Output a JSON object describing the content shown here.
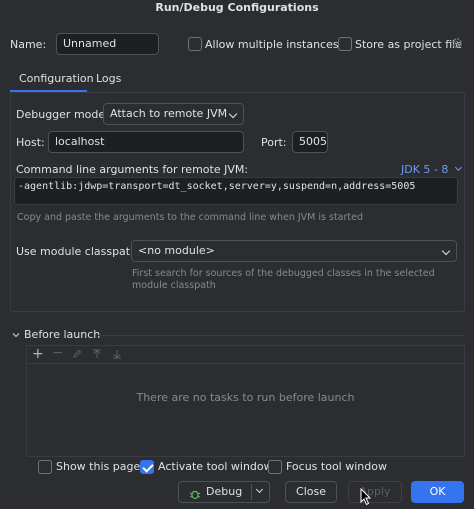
{
  "dialog": {
    "title": "Run/Debug Configurations"
  },
  "name_row": {
    "label": "Name:",
    "value": "Unnamed",
    "allow_multiple": {
      "label": "Allow multiple instances",
      "checked": false
    },
    "store_as_file": {
      "label": "Store as project file",
      "checked": false
    }
  },
  "tabs": [
    {
      "label": "Configuration",
      "active": true
    },
    {
      "label": "Logs",
      "active": false
    }
  ],
  "config": {
    "debugger_mode_label": "Debugger mode:",
    "debugger_mode_value": "Attach to remote JVM",
    "host_label": "Host:",
    "host_value": "localhost",
    "port_label": "Port:",
    "port_value": "5005",
    "cmdline_label": "Command line arguments for remote JVM:",
    "jdk_label": "JDK 5 - 8",
    "cmdline_value": "-agentlib:jdwp=transport=dt_socket,server=y,suspend=n,address=5005",
    "cmdline_hint": "Copy and paste the arguments to the command line when JVM is started",
    "classpath_label": "Use module classpath:",
    "classpath_value": "<no module>",
    "classpath_hint_line1": "First search for sources of the debugged classes in the selected",
    "classpath_hint_line2": "module classpath"
  },
  "before_launch": {
    "title": "Before launch",
    "empty_text": "There are no tasks to run before launch",
    "toolbar": [
      "plus-icon",
      "minus-icon",
      "edit-icon",
      "move-up-icon",
      "move-down-icon"
    ]
  },
  "footer_options": {
    "show_page": {
      "label": "Show this page",
      "checked": false
    },
    "activate_tool": {
      "label": "Activate tool window",
      "checked": true
    },
    "focus_tool": {
      "label": "Focus tool window",
      "checked": false
    }
  },
  "buttons": {
    "debug": "Debug",
    "close": "Close",
    "apply": "Apply",
    "ok": "OK"
  },
  "colors": {
    "accent": "#3574f0",
    "background": "#2b2d30",
    "link": "#6e9bf5",
    "debug_icon": "#5fb865"
  }
}
